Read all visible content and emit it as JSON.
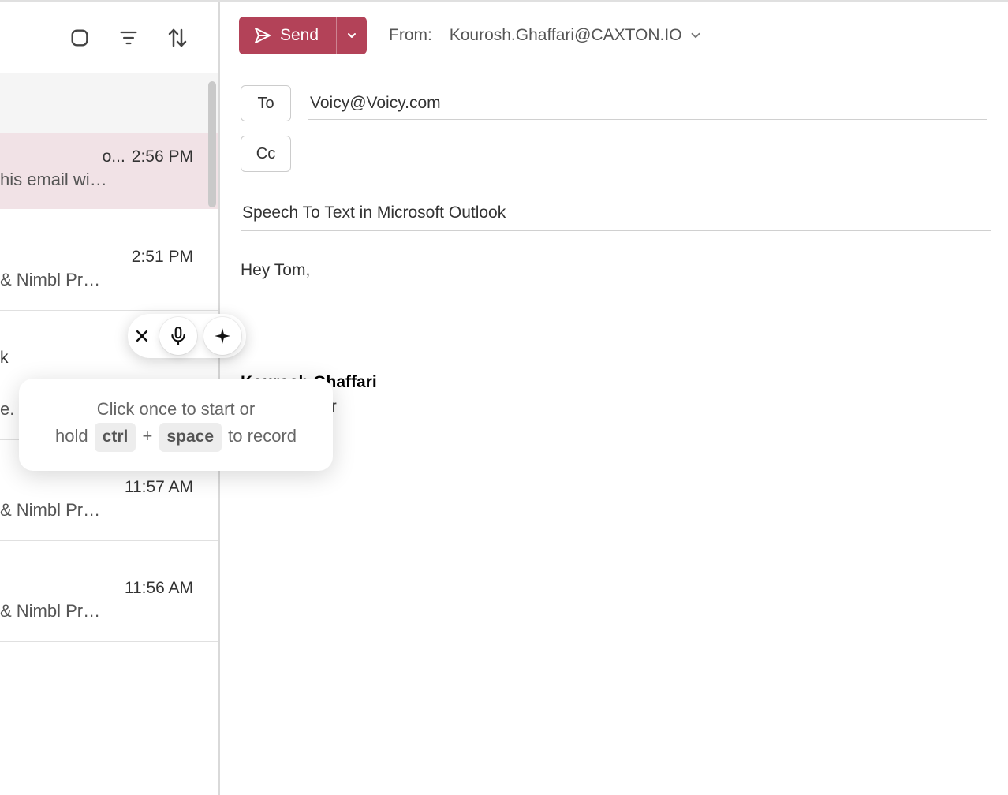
{
  "colors": {
    "accent": "#b34258",
    "selected_row_bg": "#f1e2e6"
  },
  "list_toolbar": {
    "icons": [
      "unread-icon",
      "filter-icon",
      "sort-icon"
    ]
  },
  "messages": [
    {
      "sender_tail": "o...",
      "time": "2:56 PM",
      "preview": "his email wi…",
      "selected": true
    },
    {
      "sender_tail": "",
      "time": "2:51 PM",
      "preview": "& Nimbl Pr…"
    },
    {
      "sender_tail_left": "k",
      "time": "",
      "preview": "e."
    },
    {
      "sender_tail": "",
      "time": "11:57 AM",
      "preview": "& Nimbl Pr…"
    },
    {
      "sender_tail": "",
      "time": "11:56 AM",
      "preview": "& Nimbl Pr…"
    }
  ],
  "compose": {
    "send_label": "Send",
    "from_label": "From:",
    "from_email": "Kourosh.Ghaffari@CAXTON.IO",
    "to_label": "To",
    "to_value": "Voicy@Voicy.com",
    "cc_label": "Cc",
    "cc_value": "",
    "subject": "Speech To Text in Microsoft Outlook",
    "body_greeting": "Hey Tom,",
    "signature_name": "Kourosh Ghaffari",
    "signature_title_tail": "under"
  },
  "voicy": {
    "close_label": "close",
    "mic_label": "microphone",
    "spark_label": "sparkle"
  },
  "hint": {
    "line1": "Click once to start or",
    "line2_prefix": "hold",
    "key1": "ctrl",
    "plus": "+",
    "key2": "space",
    "line2_suffix": "to record"
  }
}
